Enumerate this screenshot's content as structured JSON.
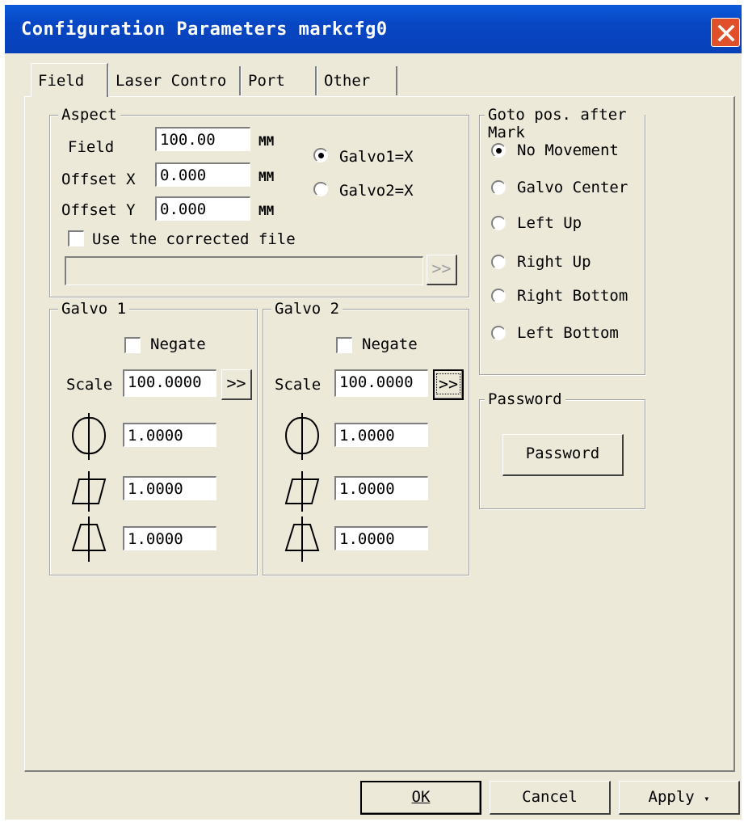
{
  "window": {
    "title": "Configuration Parameters markcfg0"
  },
  "tabs": [
    {
      "label": "Field",
      "active": true
    },
    {
      "label": "Laser Contro",
      "active": false
    },
    {
      "label": "Port",
      "active": false
    },
    {
      "label": "Other",
      "active": false
    }
  ],
  "aspect": {
    "title": "Aspect",
    "field_label": "Field",
    "field_value": "100.00",
    "offset_x_label": "Offset X",
    "offset_x_value": "0.000",
    "offset_y_label": "Offset Y",
    "offset_y_value": "0.000",
    "unit": "MM",
    "galvo1_label": "Galvo1=X",
    "galvo2_label": "Galvo2=X",
    "galvo_selected": "Galvo1=X",
    "corrected_file_label": "Use the corrected file",
    "corrected_file_checked": false,
    "corrected_file_path": "",
    "browse_label": ">>"
  },
  "galvo1": {
    "title": "Galvo 1",
    "negate_label": "Negate",
    "negate_checked": false,
    "scale_label": "Scale",
    "scale_value": "100.0000",
    "more_label": ">>",
    "param1_value": "1.0000",
    "param2_value": "1.0000",
    "param3_value": "1.0000"
  },
  "galvo2": {
    "title": "Galvo 2",
    "negate_label": "Negate",
    "negate_checked": false,
    "scale_label": "Scale",
    "scale_value": "100.0000",
    "more_label": ">>",
    "param1_value": "1.0000",
    "param2_value": "1.0000",
    "param3_value": "1.0000"
  },
  "goto": {
    "title": "Goto pos. after Mark",
    "options": [
      "No Movement",
      "Galvo Center",
      "Left Up",
      "Right Up",
      "Right Bottom",
      "Left Bottom"
    ],
    "selected": "No Movement"
  },
  "password": {
    "title": "Password",
    "button_label": "Password"
  },
  "footer": {
    "ok_label": "OK",
    "cancel_label": "Cancel",
    "apply_label": "Apply"
  }
}
